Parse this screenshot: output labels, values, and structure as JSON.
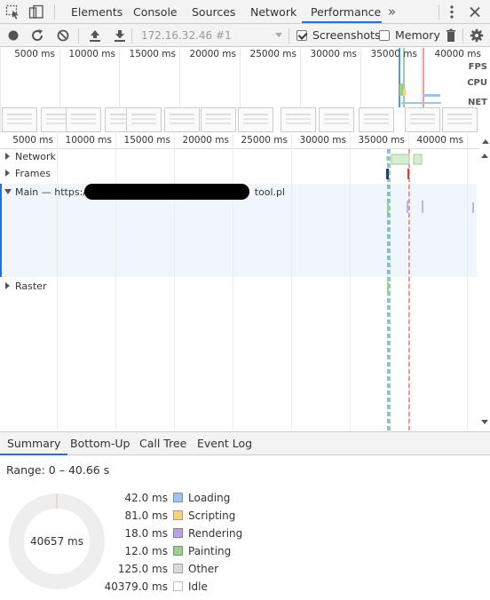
{
  "tabs": [
    {
      "label": "Elements",
      "active": false
    },
    {
      "label": "Console",
      "active": false
    },
    {
      "label": "Sources",
      "active": false
    },
    {
      "label": "Network",
      "active": false
    },
    {
      "label": "Performance",
      "active": true
    }
  ],
  "tab_more": "»",
  "toolbar": {
    "target": "172.16.32.46 #1",
    "screenshots_label": "Screenshots",
    "screenshots_checked": true,
    "memory_label": "Memory",
    "memory_checked": false
  },
  "overview": {
    "time_labels": [
      "5000 ms",
      "10000 ms",
      "15000 ms",
      "20000 ms",
      "25000 ms",
      "30000 ms",
      "35000 ms",
      "40000 ms"
    ],
    "fps_label": "FPS",
    "cpu_label": "CPU",
    "net_label": "NET"
  },
  "timeline": {
    "time_labels": [
      "5000 ms",
      "10000 ms",
      "15000 ms",
      "20000 ms",
      "25000 ms",
      "30000 ms",
      "35000 ms",
      "40000 ms"
    ],
    "tracks": {
      "network": "Network",
      "frames": "Frames",
      "main_prefix": "Main — https://",
      "main_suffix": "tool.pl",
      "raster": "Raster"
    }
  },
  "bottom_tabs": [
    {
      "label": "Summary",
      "active": true
    },
    {
      "label": "Bottom-Up",
      "active": false
    },
    {
      "label": "Call Tree",
      "active": false
    },
    {
      "label": "Event Log",
      "active": false
    }
  ],
  "summary": {
    "range": "Range: 0 – 40.66 s",
    "total": "40657 ms",
    "legend": [
      {
        "value": "42.0 ms",
        "name": "Loading",
        "color": "#a0c3ed"
      },
      {
        "value": "81.0 ms",
        "name": "Scripting",
        "color": "#f2d283"
      },
      {
        "value": "18.0 ms",
        "name": "Rendering",
        "color": "#b9a2e8"
      },
      {
        "value": "12.0 ms",
        "name": "Painting",
        "color": "#9ccf8f"
      },
      {
        "value": "125.0 ms",
        "name": "Other",
        "color": "#dadada"
      },
      {
        "value": "40379.0 ms",
        "name": "Idle",
        "color": "#ffffff"
      }
    ]
  },
  "colors": {
    "accent": "#1a73e8",
    "marker_red": "#e53935",
    "marker_green": "#2e9e4f"
  }
}
